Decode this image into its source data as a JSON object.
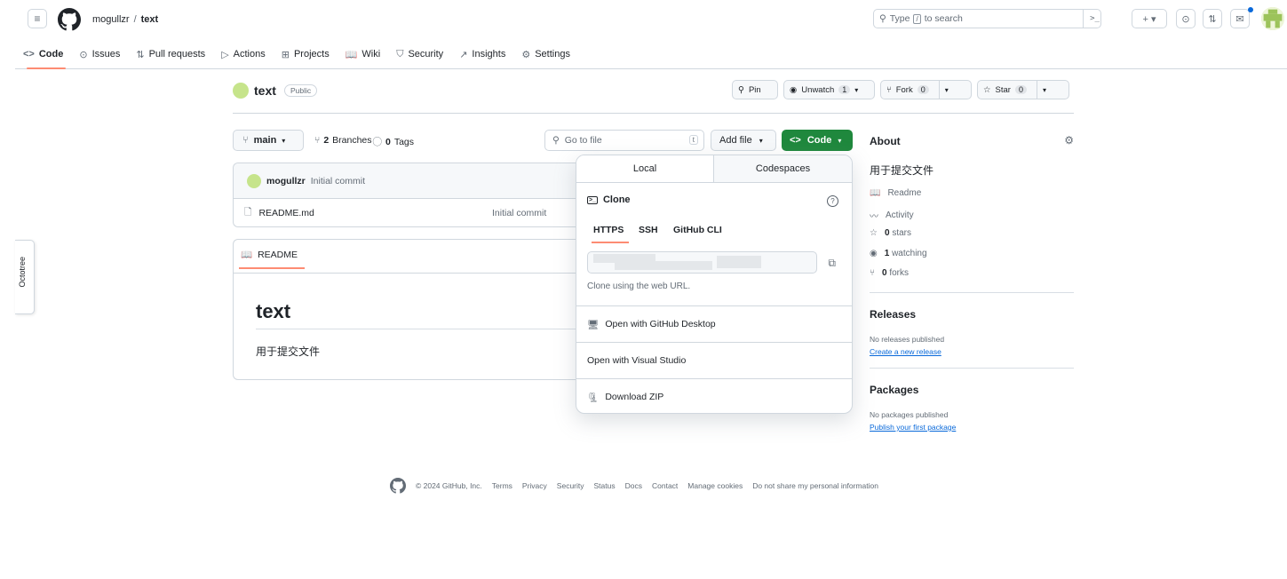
{
  "header": {
    "owner": "mogullzr",
    "separator": "/",
    "repo": "text",
    "search_placeholder_pre": "Type",
    "search_key": "/",
    "search_placeholder_post": "to search",
    "search_cmd": ">_",
    "plus_label": "+ ▾"
  },
  "tabs": [
    {
      "label": "Code",
      "icon": "<>"
    },
    {
      "label": "Issues",
      "icon": "⊙"
    },
    {
      "label": "Pull requests",
      "icon": "⇅"
    },
    {
      "label": "Actions",
      "icon": "▷"
    },
    {
      "label": "Projects",
      "icon": "⊞"
    },
    {
      "label": "Wiki",
      "icon": "📖"
    },
    {
      "label": "Security",
      "icon": "⛉"
    },
    {
      "label": "Insights",
      "icon": "↗"
    },
    {
      "label": "Settings",
      "icon": "⚙"
    }
  ],
  "repo": {
    "name": "text",
    "visibility": "Public",
    "pin": "Pin",
    "unwatch": "Unwatch",
    "watch_count": "1",
    "fork": "Fork",
    "fork_count": "0",
    "star": "Star",
    "star_count": "0"
  },
  "toolbar": {
    "branch": "main",
    "branches_count": "2",
    "branches_label": "Branches",
    "tags_count": "0",
    "tags_label": "Tags",
    "goto_placeholder": "Go to file",
    "goto_key": "t",
    "add_file": "Add file",
    "code": "Code"
  },
  "commit": {
    "author": "mogullzr",
    "message": "Initial commit"
  },
  "files": [
    {
      "name": "README.md",
      "message": "Initial commit"
    }
  ],
  "readme": {
    "tab": "README",
    "title": "text",
    "body": "用于提交文件"
  },
  "dropdown": {
    "tab_local": "Local",
    "tab_codespaces": "Codespaces",
    "clone_label": "Clone",
    "protocols": [
      "HTTPS",
      "SSH",
      "GitHub CLI"
    ],
    "clone_hint": "Clone using the web URL.",
    "open_desktop": "Open with GitHub Desktop",
    "open_vs": "Open with Visual Studio",
    "download_zip": "Download ZIP"
  },
  "about": {
    "title": "About",
    "description": "用于提交文件",
    "readme": "Readme",
    "activity": "Activity",
    "stars_count": "0",
    "stars_label": "stars",
    "watching_count": "1",
    "watching_label": "watching",
    "forks_count": "0",
    "forks_label": "forks"
  },
  "releases": {
    "title": "Releases",
    "none": "No releases published",
    "link": "Create a new release"
  },
  "packages": {
    "title": "Packages",
    "none": "No packages published",
    "link": "Publish your first package"
  },
  "footer": {
    "copyright": "© 2024 GitHub, Inc.",
    "links": [
      "Terms",
      "Privacy",
      "Security",
      "Status",
      "Docs",
      "Contact",
      "Manage cookies",
      "Do not share my personal information"
    ]
  },
  "octotree": {
    "label": "Octotree"
  },
  "colors": {
    "accent_green": "#1f883d",
    "tab_underline": "#fd8c73",
    "link_blue": "#0969da"
  }
}
